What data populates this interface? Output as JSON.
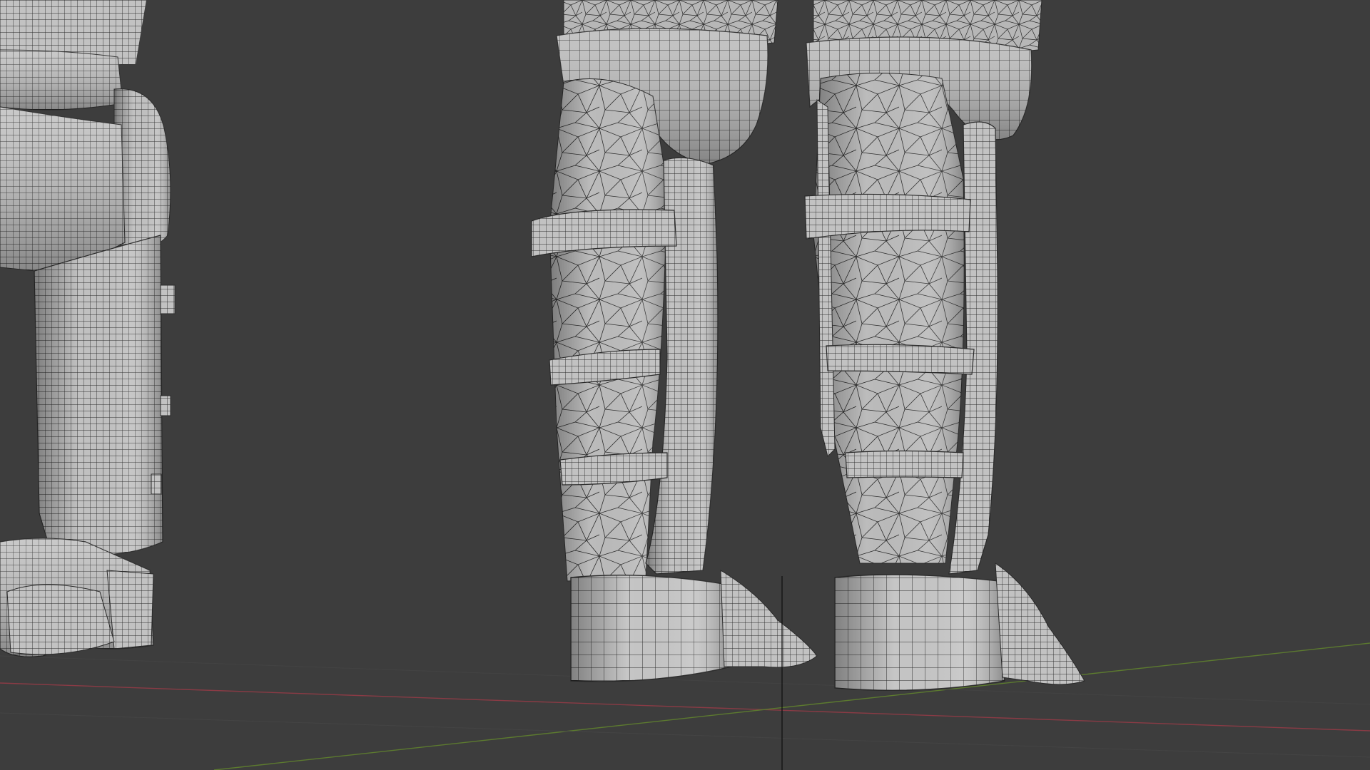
{
  "viewport": {
    "mode": "3D Viewport",
    "background_color": "#3d3d3d",
    "shading": "solid-wireframe-overlay"
  },
  "axes": {
    "x_axis_color": "#8a3b45",
    "y_axis_color": "#5c7a2f"
  },
  "cursor": {
    "type": "crosshair"
  },
  "objects": [
    {
      "label": "left-leg-armor",
      "mesh": "quad"
    },
    {
      "label": "center-leg-armor",
      "mesh": "mixed"
    },
    {
      "label": "right-leg-armor",
      "mesh": "mixed"
    }
  ],
  "colors": {
    "mesh_fill": "#b9b9b9",
    "mesh_fill_light": "#cfcfcf",
    "mesh_fill_dark": "#8e8e8e",
    "wire": "#2a2a2a"
  }
}
